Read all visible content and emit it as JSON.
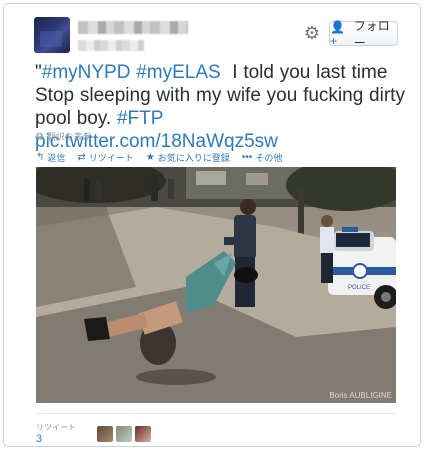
{
  "header": {
    "follow_label": "フォロー"
  },
  "tweet": {
    "parts": {
      "q": "\"",
      "tag1": "#myNYPD",
      "tag2": "#myELAS",
      "line1": "I told you last time Stop sleeping with my wife you fucking dirty pool boy.",
      "tag3": "#FTP",
      "link": "pic.twitter.com/18NaWqz5sw"
    },
    "translate": "翻訳を表示"
  },
  "actions": {
    "reply": "返信",
    "retweet": "リツイート",
    "favorite": "お気に入りに登録",
    "more": "その他"
  },
  "photo": {
    "credit": "Boris AUBLIGINE",
    "car_text": "POLICE"
  },
  "stats": {
    "retweets_label": "リツイート",
    "retweets_count": "3"
  },
  "colors": {
    "link": "#2b7bb9",
    "text": "#292f33",
    "muted": "#8899a6"
  }
}
